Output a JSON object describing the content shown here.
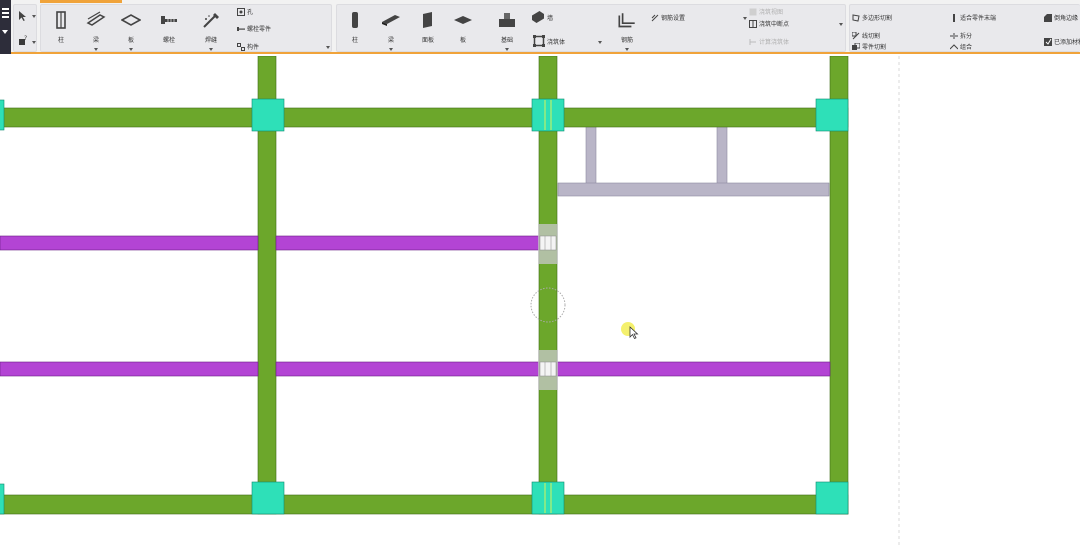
{
  "ribbon": {
    "groups": {
      "select": {
        "items": [
          {
            "name": "select-arrow-icon",
            "label": ""
          },
          {
            "name": "query-icon",
            "label": ""
          }
        ]
      },
      "steel": {
        "buttons": [
          {
            "name": "steel-column",
            "label": "柱"
          },
          {
            "name": "steel-beam",
            "label": "梁"
          },
          {
            "name": "steel-plate",
            "label": "板"
          },
          {
            "name": "bolt",
            "label": "螺栓"
          },
          {
            "name": "weld",
            "label": "焊缝"
          }
        ],
        "small": [
          {
            "name": "hole",
            "label": "孔"
          },
          {
            "name": "bolt-part",
            "label": "螺栓零件"
          },
          {
            "name": "component",
            "label": "构件"
          }
        ]
      },
      "concrete": {
        "buttons": [
          {
            "name": "concrete-column",
            "label": "柱"
          },
          {
            "name": "concrete-beam",
            "label": "梁"
          },
          {
            "name": "panel",
            "label": "面板"
          },
          {
            "name": "slab",
            "label": "板"
          },
          {
            "name": "footing",
            "label": "基础"
          }
        ],
        "small": [
          {
            "name": "wall",
            "label": "墙"
          },
          {
            "name": "pour-object",
            "label": "浇筑体"
          }
        ],
        "rebar": {
          "label": "钢筋"
        },
        "rebar_settings": {
          "label": "钢筋设置"
        },
        "pour_items": [
          {
            "name": "pour-view",
            "label": "浇筑视图",
            "disabled": true
          },
          {
            "name": "pour-break",
            "label": "浇筑中断点",
            "disabled": false
          },
          {
            "name": "calc-pour",
            "label": "计算浇筑体",
            "disabled": true
          }
        ]
      },
      "edit": {
        "items": [
          {
            "name": "polygon-cut",
            "label": "多边形切割"
          },
          {
            "name": "fit-part-end",
            "label": "适合零件末端"
          },
          {
            "name": "chamfer-edge",
            "label": "倒角边缘"
          },
          {
            "name": "line-cut",
            "label": "线切割"
          },
          {
            "name": "split",
            "label": "拆分"
          },
          {
            "name": "part-cut",
            "label": "零件切割"
          },
          {
            "name": "combine",
            "label": "组合"
          },
          {
            "name": "added-material",
            "label": "已添加材料"
          }
        ]
      }
    }
  },
  "colors": {
    "ribbon_bg": "#f2f2f2",
    "group_bg": "#e9e9ec",
    "accent": "#f0a33a",
    "app_menu": "#2d2d3a",
    "column": "#6ca72b",
    "beam_primary": "#6ca72b",
    "beam_secondary": "#b344d4",
    "joint": "#2ee0b8",
    "steel_member": "#b9b5c7",
    "cursor": "#f0eb3c"
  }
}
